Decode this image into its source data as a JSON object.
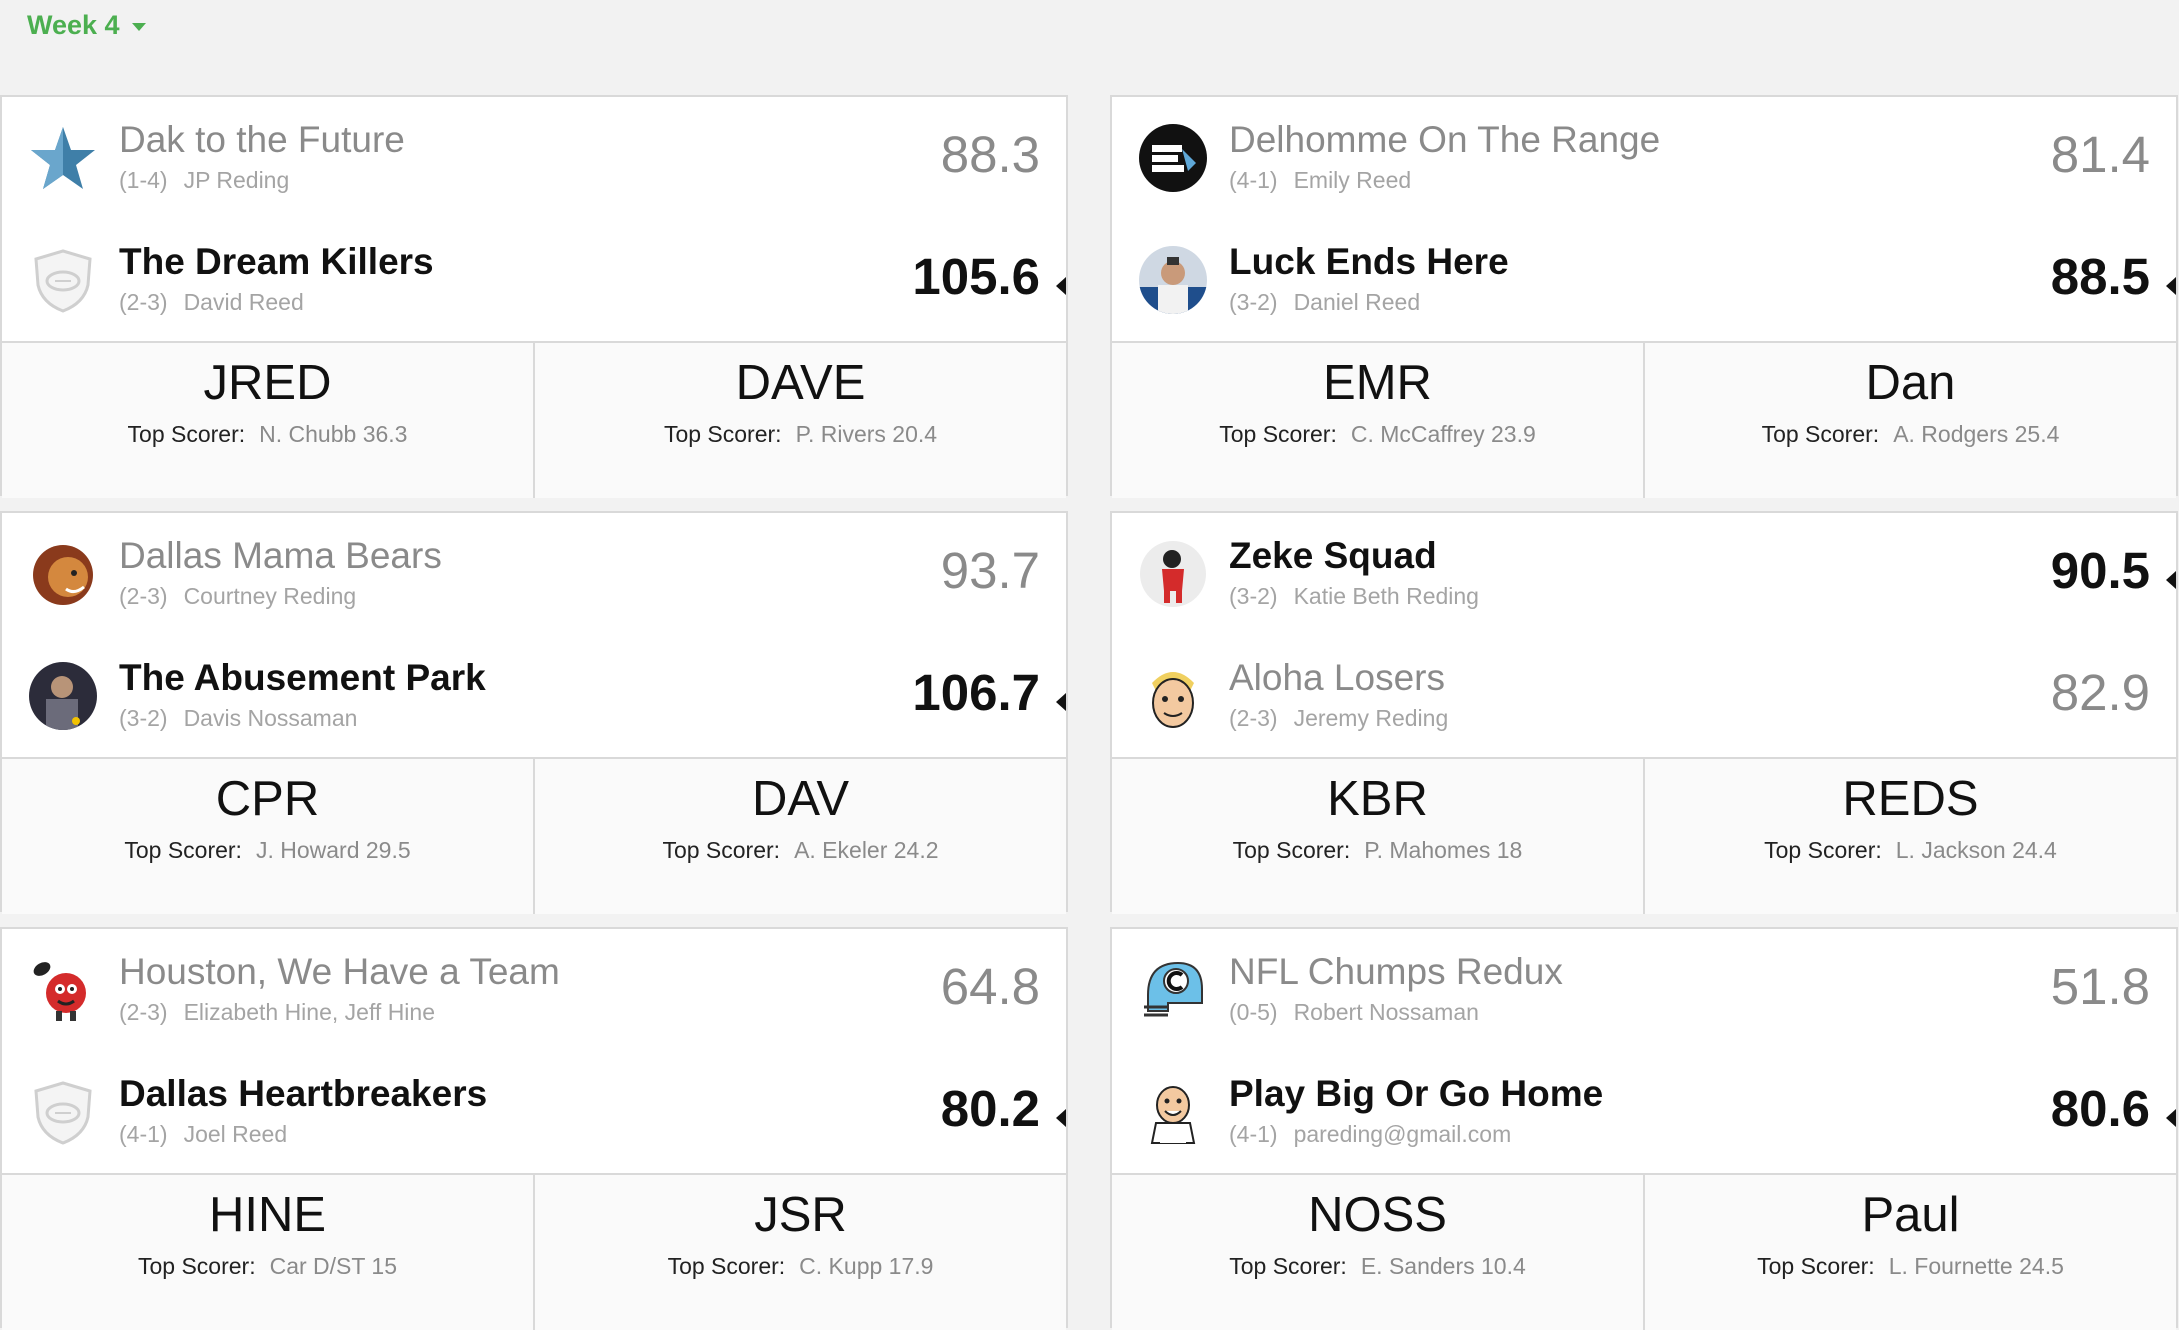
{
  "week_selector": {
    "label": "Week 4"
  },
  "matchups": [
    {
      "teams": [
        {
          "name": "Dak to the Future",
          "record": "(1-4)",
          "owner": "JP Reding",
          "score": "88.3",
          "winner": false,
          "logo": "star-icon"
        },
        {
          "name": "The Dream Killers",
          "record": "(2-3)",
          "owner": "David Reed",
          "score": "105.6",
          "winner": true,
          "logo": "default-shield-icon"
        }
      ],
      "footer": [
        {
          "abbr": "JRED",
          "top_label": "Top Scorer:",
          "top_value": "N. Chubb 36.3"
        },
        {
          "abbr": "DAVE",
          "top_label": "Top Scorer:",
          "top_value": "P. Rivers 20.4"
        }
      ]
    },
    {
      "teams": [
        {
          "name": "Delhomme On The Range",
          "record": "(4-1)",
          "owner": "Emily Reed",
          "score": "81.4",
          "winner": false,
          "logo": "delhomme-badge-icon"
        },
        {
          "name": "Luck Ends Here",
          "record": "(3-2)",
          "owner": "Daniel Reed",
          "score": "88.5",
          "winner": true,
          "logo": "player-photo-icon"
        }
      ],
      "footer": [
        {
          "abbr": "EMR",
          "top_label": "Top Scorer:",
          "top_value": "C. McCaffrey 23.9"
        },
        {
          "abbr": "Dan",
          "top_label": "Top Scorer:",
          "top_value": "A. Rodgers 25.4"
        }
      ]
    },
    {
      "teams": [
        {
          "name": "Dallas Mama Bears",
          "record": "(2-3)",
          "owner": "Courtney Reding",
          "score": "93.7",
          "winner": false,
          "logo": "lion-icon"
        },
        {
          "name": "The Abusement Park",
          "record": "(3-2)",
          "owner": "Davis Nossaman",
          "score": "106.7",
          "winner": true,
          "logo": "photo-avatar-icon"
        }
      ],
      "footer": [
        {
          "abbr": "CPR",
          "top_label": "Top Scorer:",
          "top_value": "J. Howard 29.5"
        },
        {
          "abbr": "DAV",
          "top_label": "Top Scorer:",
          "top_value": "A. Ekeler 24.2"
        }
      ]
    },
    {
      "teams": [
        {
          "name": "Zeke Squad",
          "record": "(3-2)",
          "owner": "Katie Beth Reding",
          "score": "90.5",
          "winner": true,
          "logo": "cartoon-player-icon"
        },
        {
          "name": "Aloha Losers",
          "record": "(2-3)",
          "owner": "Jeremy Reding",
          "score": "82.9",
          "winner": false,
          "logo": "cartoon-face-icon"
        }
      ],
      "footer": [
        {
          "abbr": "KBR",
          "top_label": "Top Scorer:",
          "top_value": "P. Mahomes 18"
        },
        {
          "abbr": "REDS",
          "top_label": "Top Scorer:",
          "top_value": "L. Jackson 24.4"
        }
      ]
    },
    {
      "teams": [
        {
          "name": "Houston, We Have a Team",
          "record": "(2-3)",
          "owner": "Elizabeth Hine, Jeff Hine",
          "score": "64.8",
          "winner": false,
          "logo": "mascot-football-icon"
        },
        {
          "name": "Dallas Heartbreakers",
          "record": "(4-1)",
          "owner": "Joel Reed",
          "score": "80.2",
          "winner": true,
          "logo": "default-shield-icon"
        }
      ],
      "footer": [
        {
          "abbr": "HINE",
          "top_label": "Top Scorer:",
          "top_value": "Car D/ST 15"
        },
        {
          "abbr": "JSR",
          "top_label": "Top Scorer:",
          "top_value": "C. Kupp 17.9"
        }
      ]
    },
    {
      "teams": [
        {
          "name": "NFL Chumps Redux",
          "record": "(0-5)",
          "owner": "Robert Nossaman",
          "score": "51.8",
          "winner": false,
          "logo": "helmet-icon"
        },
        {
          "name": "Play Big Or Go Home",
          "record": "(4-1)",
          "owner": "pareding@gmail.com",
          "score": "80.6",
          "winner": true,
          "logo": "yes-cartoon-icon"
        }
      ],
      "footer": [
        {
          "abbr": "NOSS",
          "top_label": "Top Scorer:",
          "top_value": "E. Sanders 10.4"
        },
        {
          "abbr": "Paul",
          "top_label": "Top Scorer:",
          "top_value": "L. Fournette 24.5"
        }
      ]
    }
  ],
  "colors": {
    "accent": "#4caf50",
    "border": "#d9d9d9",
    "loser_text": "#8a8a8a",
    "winner_text": "#111111"
  }
}
